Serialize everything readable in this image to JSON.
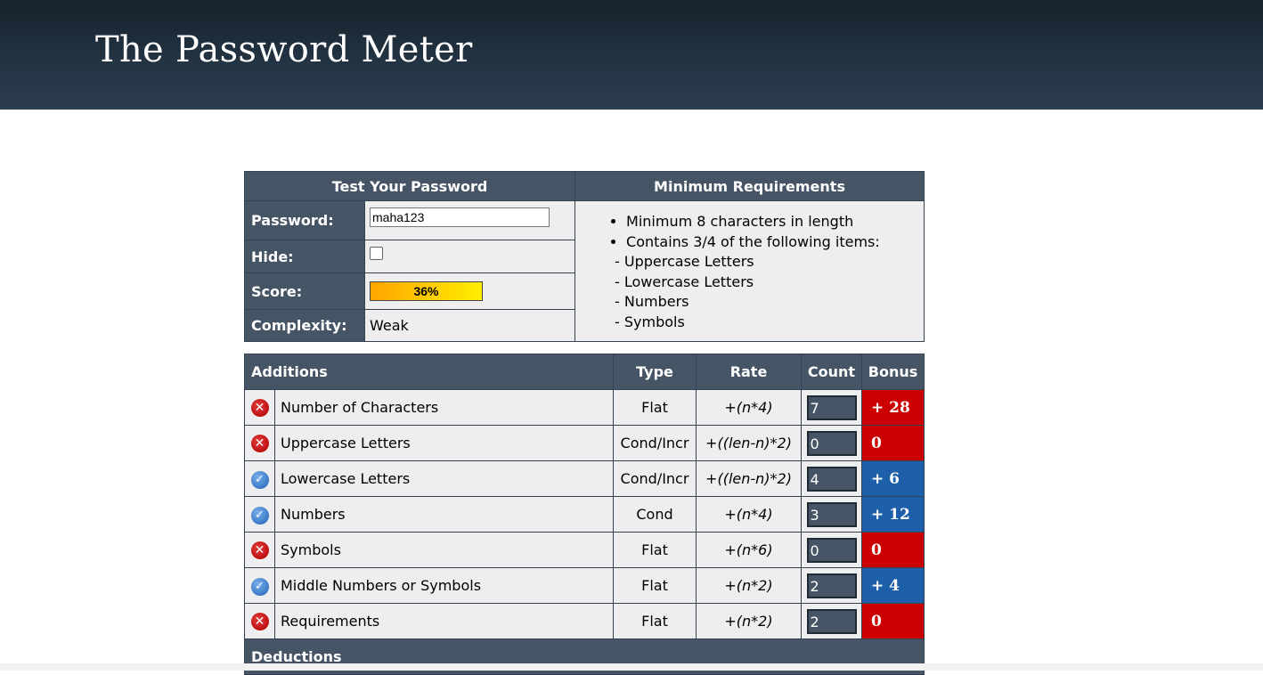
{
  "header": {
    "title": "The Password Meter"
  },
  "test": {
    "heading": "Test Your Password",
    "password_label": "Password:",
    "password_value": "maha123",
    "hide_label": "Hide:",
    "score_label": "Score:",
    "score_value": "36%",
    "score_fraction": 0.36,
    "complexity_label": "Complexity:",
    "complexity_value": "Weak"
  },
  "requirements": {
    "heading": "Minimum Requirements",
    "items": [
      "Minimum 8 characters in length",
      "Contains 3/4 of the following items:",
      "- Uppercase Letters",
      "- Lowercase Letters",
      "- Numbers",
      "- Symbols"
    ]
  },
  "additions": {
    "headers": {
      "name": "Additions",
      "type": "Type",
      "rate": "Rate",
      "count": "Count",
      "bonus": "Bonus"
    },
    "rows": [
      {
        "status": "fail",
        "name": "Number of Characters",
        "type": "Flat",
        "rate": "+(n*4)",
        "count": "7",
        "bonus": "+ 28"
      },
      {
        "status": "fail",
        "name": "Uppercase Letters",
        "type": "Cond/Incr",
        "rate": "+((len-n)*2)",
        "count": "0",
        "bonus": "0"
      },
      {
        "status": "pass",
        "name": "Lowercase Letters",
        "type": "Cond/Incr",
        "rate": "+((len-n)*2)",
        "count": "4",
        "bonus": "+ 6"
      },
      {
        "status": "pass",
        "name": "Numbers",
        "type": "Cond",
        "rate": "+(n*4)",
        "count": "3",
        "bonus": "+ 12"
      },
      {
        "status": "fail",
        "name": "Symbols",
        "type": "Flat",
        "rate": "+(n*6)",
        "count": "0",
        "bonus": "0"
      },
      {
        "status": "pass",
        "name": "Middle Numbers or Symbols",
        "type": "Flat",
        "rate": "+(n*2)",
        "count": "2",
        "bonus": "+ 4"
      },
      {
        "status": "fail",
        "name": "Requirements",
        "type": "Flat",
        "rate": "+(n*2)",
        "count": "2",
        "bonus": "0"
      }
    ]
  },
  "deductions": {
    "heading": "Deductions"
  },
  "colors": {
    "header_bg": "#1e2d3b",
    "panel": "#465566",
    "bonus_bad": "#cc0000",
    "bonus_good": "#1d5fa8",
    "score_from": "#ffa500",
    "score_to": "#ffee00"
  },
  "icons": {
    "fail": "red-x-icon",
    "pass": "blue-check-icon"
  }
}
